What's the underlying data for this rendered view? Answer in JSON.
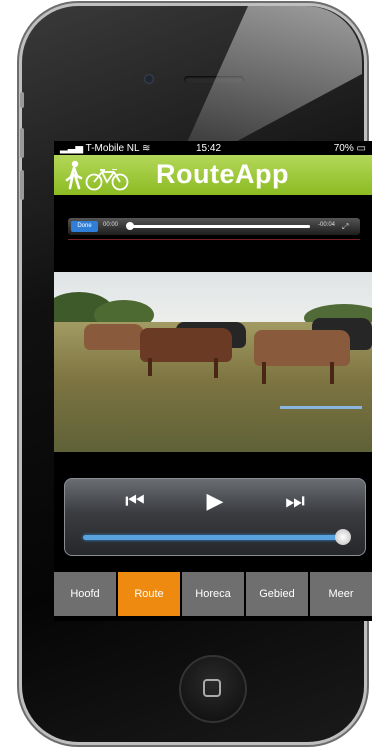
{
  "status_bar": {
    "carrier": "T-Mobile NL",
    "time": "15:42",
    "battery": "70%"
  },
  "header": {
    "title": "RouteApp",
    "walker_icon": "pedestrian-icon",
    "bike_icon": "bicycle-icon",
    "background_color": "#9ac63a"
  },
  "video_scrubber": {
    "done_label": "Done",
    "elapsed": "00:00",
    "remaining": "-00:04",
    "progress": 0.0
  },
  "playback": {
    "prev_icon": "skip-back-icon",
    "play_icon": "play-icon",
    "next_icon": "skip-forward-icon",
    "volume": 1.0
  },
  "tabs": [
    {
      "label": "Hoofd",
      "active": false
    },
    {
      "label": "Route",
      "active": true
    },
    {
      "label": "Horeca",
      "active": false
    },
    {
      "label": "Gebied",
      "active": false
    },
    {
      "label": "Meer",
      "active": false
    }
  ],
  "colors": {
    "active_tab": "#ee8a0f",
    "inactive_tab": "#6f6f6f",
    "volume_bar": "#58a3df"
  }
}
